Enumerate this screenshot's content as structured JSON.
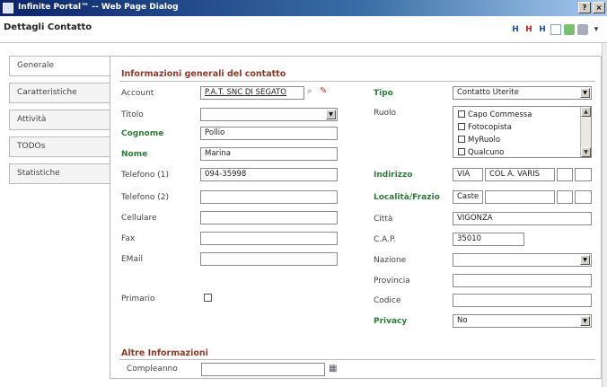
{
  "window": {
    "title": "Infinite Portal™ -- Web Page Dialog",
    "help_btn": "?",
    "close_btn": "×"
  },
  "header": {
    "title": "Dettagli Contatto"
  },
  "toolbar": [
    {
      "icon": "save-icon",
      "glyph": "H"
    },
    {
      "icon": "save-close-icon",
      "glyph": "H"
    },
    {
      "icon": "save-new-icon",
      "glyph": "H"
    },
    {
      "icon": "document-icon",
      "glyph": ""
    },
    {
      "icon": "export-icon",
      "glyph": ""
    },
    {
      "icon": "print-icon",
      "glyph": ""
    },
    {
      "icon": "menu-icon",
      "glyph": "▾"
    }
  ],
  "tabs": [
    "Generale",
    "Caratteristiche",
    "Attività",
    "TODOs",
    "Statistiche"
  ],
  "section_general": "Informazioni generali del contatto",
  "section_other": "Altre Informazioni",
  "left": {
    "account": {
      "label": "Account",
      "value": "P.A.T. SNC DI SEGATO"
    },
    "titolo": {
      "label": "Titolo",
      "value": ""
    },
    "cognome": {
      "label": "Cognome",
      "value": "Pollio"
    },
    "nome": {
      "label": "Nome",
      "value": "Marina"
    },
    "tel1": {
      "label": "Telefono (1)",
      "value": "094-35998"
    },
    "tel2": {
      "label": "Telefono (2)",
      "value": ""
    },
    "cellulare": {
      "label": "Cellulare",
      "value": ""
    },
    "fax": {
      "label": "Fax",
      "value": ""
    },
    "email": {
      "label": "EMail",
      "value": ""
    },
    "primario": {
      "label": "Primario"
    }
  },
  "right": {
    "tipo": {
      "label": "Tipo",
      "value": "Contatto Uterite"
    },
    "ruolo": {
      "label": "Ruolo",
      "options": [
        "Capo Commessa",
        "Fotocopista",
        "MyRuolo",
        "Qualcuno"
      ]
    },
    "indirizzo": {
      "label": "Indirizzo",
      "value1": "VIA",
      "value2": "COL A. VARIS"
    },
    "localita": {
      "label": "Località/Frazio",
      "value": "Caste"
    },
    "citta": {
      "label": "Città",
      "value": "VIGONZA"
    },
    "cap": {
      "label": "C.A.P.",
      "value": "35010"
    },
    "nazione": {
      "label": "Nazione",
      "value": ""
    },
    "provincia": {
      "label": "Provincia",
      "value": ""
    },
    "codice": {
      "label": "Codice",
      "value": ""
    },
    "privacy": {
      "label": "Privacy",
      "value": "No"
    }
  },
  "compleanno": {
    "label": "Compleanno",
    "value": ""
  }
}
